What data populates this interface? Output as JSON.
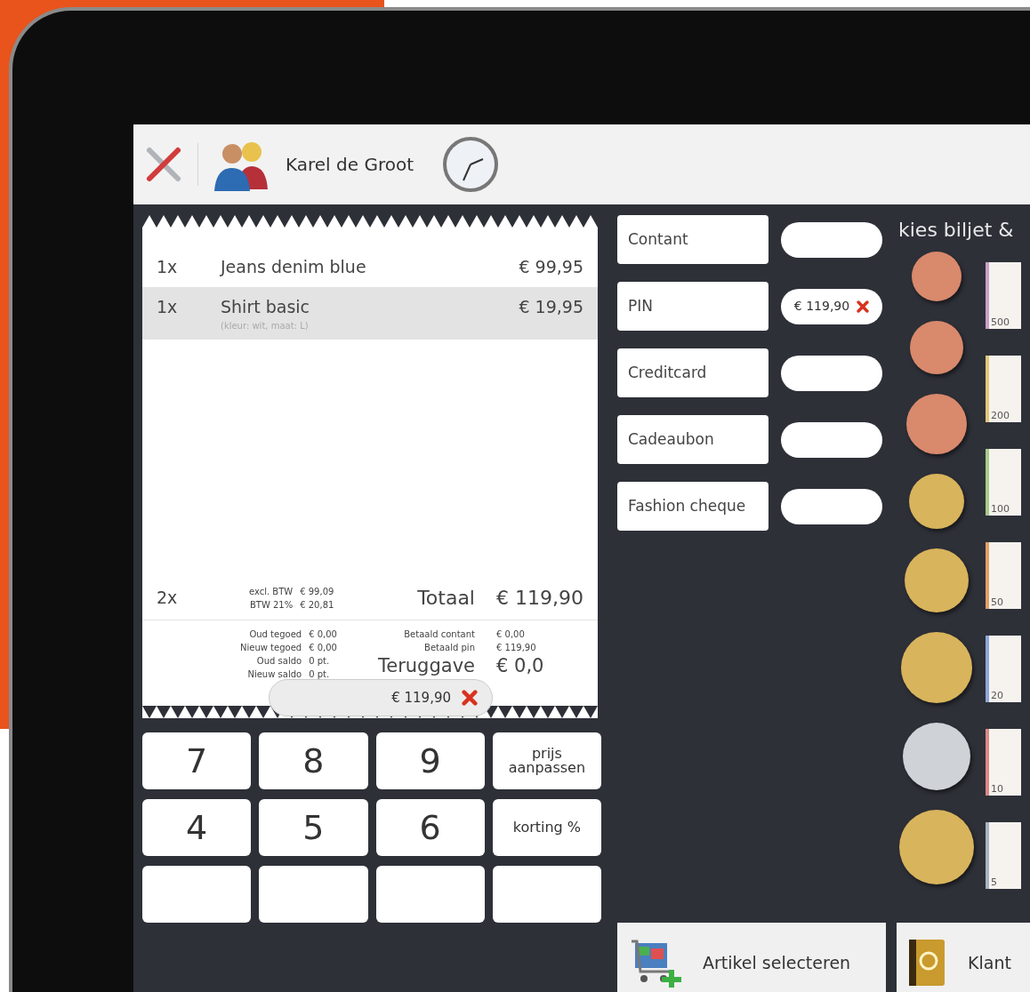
{
  "header": {
    "user": "Karel de Groot"
  },
  "receipt": {
    "lines": [
      {
        "qty": "1x",
        "description": "Jeans denim blue",
        "price": "€ 99,95",
        "selected": false
      },
      {
        "qty": "1x",
        "description": "Shirt basic",
        "note": "(kleur: wit, maat: L)",
        "price": "€ 19,95",
        "selected": true
      }
    ],
    "total": {
      "qty": "2x",
      "tax": [
        {
          "label": "excl. BTW",
          "value": "€ 99,09"
        },
        {
          "label": "BTW 21%",
          "value": "€ 20,81"
        }
      ],
      "label": "Totaal",
      "value": "€ 119,90"
    },
    "balance": [
      {
        "label": "Oud tegoed",
        "value": "€ 0,00"
      },
      {
        "label": "Nieuw tegoed",
        "value": "€ 0,00"
      },
      {
        "label": "Oud saldo",
        "value": "0 pt."
      },
      {
        "label": "Nieuw saldo",
        "value": "0 pt."
      }
    ],
    "paid": [
      {
        "label": "Betaald contant",
        "value": "€ 0,00"
      },
      {
        "label": "Betaald pin",
        "value": "€ 119,90"
      }
    ],
    "change": {
      "label": "Teruggave",
      "value": "€ 0,0"
    },
    "paid_amount": "€ 119,90"
  },
  "keypad": [
    {
      "label": "7",
      "kind": "digit"
    },
    {
      "label": "8",
      "kind": "digit"
    },
    {
      "label": "9",
      "kind": "digit"
    },
    {
      "label": "prijs aanpassen",
      "kind": "function"
    },
    {
      "label": "4",
      "kind": "digit"
    },
    {
      "label": "5",
      "kind": "digit"
    },
    {
      "label": "6",
      "kind": "digit"
    },
    {
      "label": "korting %",
      "kind": "function"
    }
  ],
  "payment_methods": [
    {
      "label": "Contant"
    },
    {
      "label": "PIN",
      "amount": "€ 119,90"
    },
    {
      "label": "Creditcard"
    },
    {
      "label": "Cadeaubon"
    },
    {
      "label": "Fashion cheque"
    }
  ],
  "denominations": {
    "title": "kies biljet &",
    "coins": [
      {
        "color": "#d9896c"
      },
      {
        "color": "#d9896c"
      },
      {
        "color": "#d9896c"
      },
      {
        "color": "#d8b45c"
      },
      {
        "color": "#d8b45c"
      },
      {
        "color": "#d8b45c"
      },
      {
        "color": "#cfd3d8"
      },
      {
        "color": "#d8b45c"
      }
    ],
    "notes": [
      {
        "label": "500",
        "color": "#c9a0c8"
      },
      {
        "label": "200",
        "color": "#e2c77a"
      },
      {
        "label": "100",
        "color": "#a9c98a"
      },
      {
        "label": "50",
        "color": "#e3a06a"
      },
      {
        "label": "20",
        "color": "#8fa8d8"
      },
      {
        "label": "10",
        "color": "#d98a8a"
      },
      {
        "label": "5",
        "color": "#a9b4bf"
      }
    ]
  },
  "actions": [
    {
      "label": "Artikel selecteren",
      "kind": "cart"
    },
    {
      "label": "Klant",
      "kind": "contacts"
    }
  ]
}
